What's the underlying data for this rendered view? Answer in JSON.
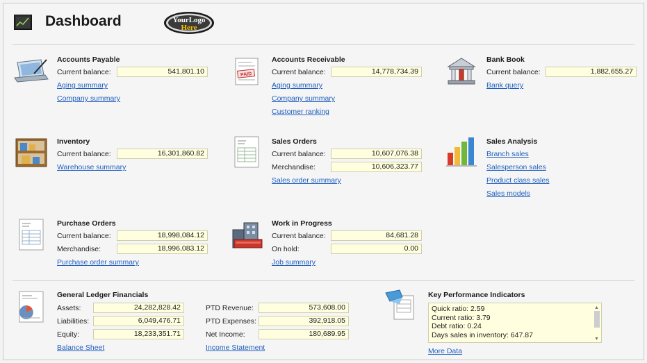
{
  "header": {
    "title": "Dashboard",
    "logo_line1": "YourLogo",
    "logo_line2": "Here"
  },
  "labels": {
    "current_balance": "Current balance:",
    "merchandise": "Merchandise:",
    "on_hold": "On hold:"
  },
  "accounts_payable": {
    "title": "Accounts Payable",
    "current_balance": "541,801.10",
    "links": [
      "Aging summary",
      "Company summary"
    ]
  },
  "accounts_receivable": {
    "title": "Accounts Receivable",
    "current_balance": "14,778,734.39",
    "links": [
      "Aging summary",
      "Company summary",
      "Customer ranking"
    ]
  },
  "bank_book": {
    "title": "Bank Book",
    "current_balance": "1,882,655.27",
    "links": [
      "Bank query"
    ]
  },
  "inventory": {
    "title": "Inventory",
    "current_balance": "16,301,860.82",
    "links": [
      "Warehouse summary"
    ]
  },
  "sales_orders": {
    "title": "Sales Orders",
    "current_balance": "10,607,076.38",
    "merchandise": "10,606,323.77",
    "links": [
      "Sales order summary"
    ]
  },
  "sales_analysis": {
    "title": "Sales Analysis",
    "links": [
      "Branch sales",
      "Salesperson sales",
      "Product class sales",
      "Sales models"
    ]
  },
  "purchase_orders": {
    "title": "Purchase Orders",
    "current_balance": "18,998,084.12",
    "merchandise": "18,996,083.12",
    "links": [
      "Purchase order summary"
    ]
  },
  "work_in_progress": {
    "title": "Work in Progress",
    "current_balance": "84,681.28",
    "on_hold": "0.00",
    "links": [
      "Job summary"
    ]
  },
  "general_ledger": {
    "title": "General Ledger Financials",
    "assets_label": "Assets:",
    "assets": "24,282,828.42",
    "liabilities_label": "Liabilities:",
    "liabilities": "6,049,476.71",
    "equity_label": "Equity:",
    "equity": "18,233,351.71",
    "ptd_revenue_label": "PTD Revenue:",
    "ptd_revenue": "573,608.00",
    "ptd_expenses_label": "PTD Expenses:",
    "ptd_expenses": "392,918.05",
    "net_income_label": "Net Income:",
    "net_income": "180,689.95",
    "links": [
      "Balance Sheet",
      "Income Statement"
    ]
  },
  "kpi": {
    "title": "Key Performance Indicators",
    "lines": [
      "Quick ratio: 2.59",
      "Current ratio: 3.79",
      "Debt ratio: 0.24",
      "Days sales in inventory: 647.87"
    ],
    "more_link": "More Data"
  },
  "colors": {
    "link": "#1f5fbf",
    "value_bg": "#ffffe0",
    "background": "#f5f5f5"
  }
}
